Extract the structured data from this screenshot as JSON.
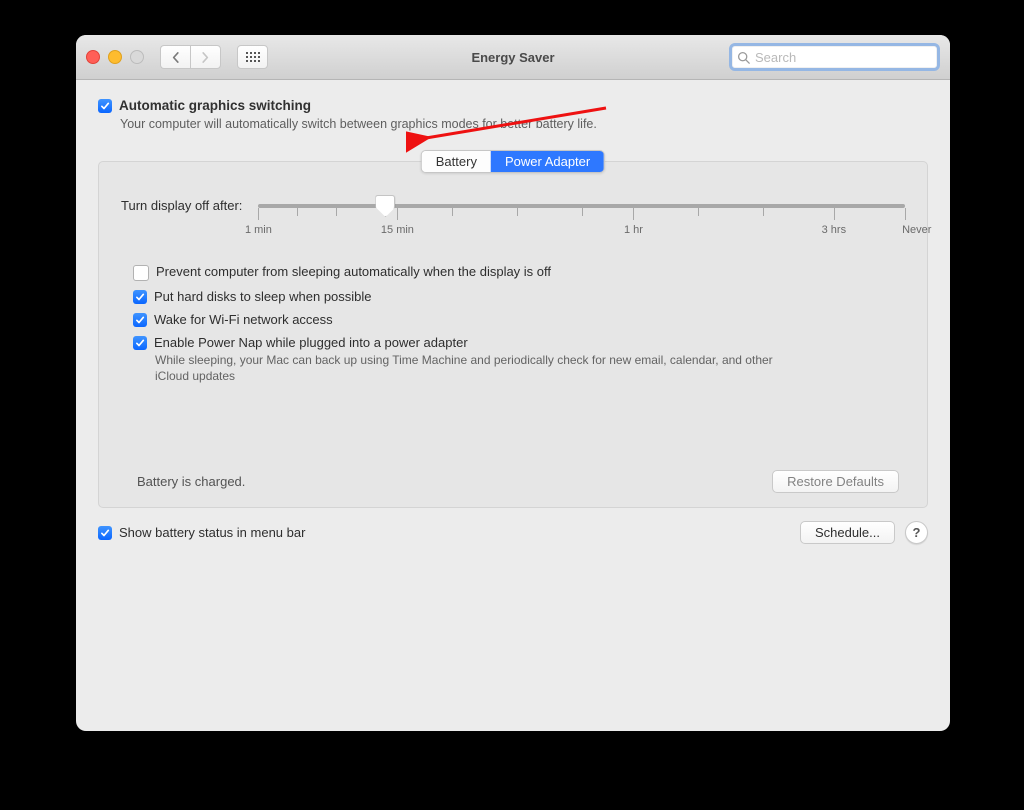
{
  "window": {
    "title": "Energy Saver",
    "search_placeholder": "Search"
  },
  "auto_graphics": {
    "label": "Automatic graphics switching",
    "checked": true,
    "description": "Your computer will automatically switch between graphics modes for better battery life."
  },
  "tabs": {
    "battery": "Battery",
    "power_adapter": "Power Adapter",
    "active": "power_adapter"
  },
  "slider": {
    "label": "Turn display off after:",
    "ticks": [
      "1 min",
      "15 min",
      "1 hr",
      "3 hrs",
      "Never"
    ]
  },
  "options": [
    {
      "checked": false,
      "label": "Prevent computer from sleeping automatically when the display is off"
    },
    {
      "checked": true,
      "label": "Put hard disks to sleep when possible"
    },
    {
      "checked": true,
      "label": "Wake for Wi-Fi network access"
    },
    {
      "checked": true,
      "label": "Enable Power Nap while plugged into a power adapter",
      "description": "While sleeping, your Mac can back up using Time Machine and periodically check for new email, calendar, and other iCloud updates"
    }
  ],
  "status_text": "Battery is charged.",
  "restore_button": "Restore Defaults",
  "footer": {
    "show_status_label": "Show battery status in menu bar",
    "show_status_checked": true,
    "schedule_button": "Schedule..."
  }
}
